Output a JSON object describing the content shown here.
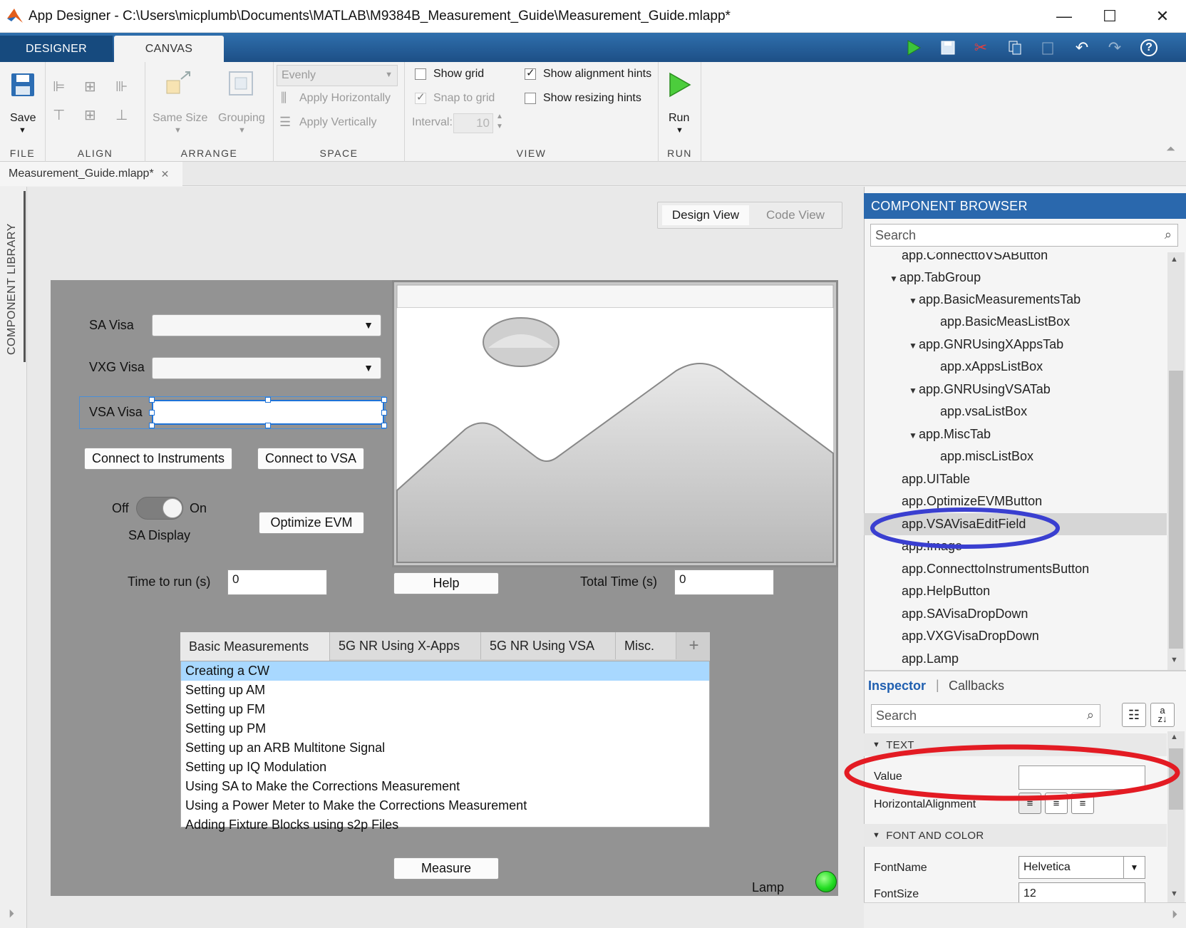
{
  "window": {
    "title": "App Designer - C:\\Users\\micplumb\\Documents\\MATLAB\\M9384B_Measurement_Guide\\Measurement_Guide.mlapp*",
    "minimize": "—",
    "maximize": "☐",
    "close": "✕"
  },
  "ribbon_tabs": [
    "DESIGNER",
    "CANVAS"
  ],
  "ribbon": {
    "file": {
      "title": "FILE",
      "save": "Save"
    },
    "align": {
      "title": "ALIGN"
    },
    "arrange": {
      "title": "ARRANGE",
      "same_size": "Same Size",
      "grouping": "Grouping"
    },
    "space": {
      "title": "SPACE",
      "select_value": "Evenly",
      "apply_h": "Apply Horizontally",
      "apply_v": "Apply Vertically"
    },
    "view": {
      "title": "VIEW",
      "show_grid": "Show grid",
      "snap_to_grid": "Snap to grid",
      "interval_label": "Interval:",
      "interval_value": "10",
      "show_alignment_hints": "Show alignment hints",
      "show_resizing_hints": "Show resizing hints",
      "show_grid_checked": false,
      "snap_checked": true,
      "alignment_checked": true,
      "resizing_checked": false
    },
    "run": {
      "title": "RUN",
      "run": "Run"
    }
  },
  "document_tab": {
    "label": "Measurement_Guide.mlapp*",
    "close": "✕"
  },
  "left_panel": {
    "label": "COMPONENT LIBRARY"
  },
  "view_toggle": {
    "design": "Design View",
    "code": "Code View"
  },
  "app": {
    "sa_visa_label": "SA Visa",
    "vxg_visa_label": "VXG Visa",
    "vsa_visa_label": "VSA Visa",
    "connect_instruments": "Connect to Instruments",
    "connect_vsa": "Connect to VSA",
    "switch_off": "Off",
    "switch_on": "On",
    "sa_display": "SA Display",
    "optimize_evm": "Optimize EVM",
    "time_to_run_label": "Time to run (s)",
    "time_to_run_value": "0",
    "help": "Help",
    "total_time_label": "Total Time (s)",
    "total_time_value": "0",
    "tabs": [
      "Basic Measurements",
      "5G NR Using X-Apps",
      "5G NR Using VSA",
      "Misc."
    ],
    "add_tab": "+",
    "list_items": [
      "Creating a CW",
      "Setting up AM",
      "Setting up FM",
      "Setting up PM",
      "Setting up an ARB Multitone Signal",
      "Setting up IQ Modulation",
      "Using SA to Make the Corrections Measurement",
      "Using a Power Meter to Make the Corrections Measurement",
      "Adding Fixture Blocks using s2p Files"
    ],
    "measure": "Measure",
    "lamp_label": "Lamp",
    "lamp_color": "#22dd22"
  },
  "component_browser": {
    "title": "COMPONENT BROWSER",
    "search_placeholder": "Search",
    "items": [
      "app.ConnecttoVSAButton",
      "app.TabGroup",
      "app.BasicMeasurementsTab",
      "app.BasicMeasListBox",
      "app.GNRUsingXAppsTab",
      "app.xAppsListBox",
      "app.GNRUsingVSATab",
      "app.vsaListBox",
      "app.MiscTab",
      "app.miscListBox",
      "app.UITable",
      "app.OptimizeEVMButton",
      "app.VSAVisaEditField",
      "app.Image",
      "app.ConnecttoInstrumentsButton",
      "app.HelpButton",
      "app.SAVisaDropDown",
      "app.VXGVisaDropDown",
      "app.Lamp"
    ],
    "selected": "app.VSAVisaEditField"
  },
  "inspector": {
    "tab_inspector": "Inspector",
    "tab_callbacks": "Callbacks",
    "search_placeholder": "Search",
    "section_text": "TEXT",
    "value_label": "Value",
    "value": "",
    "halign_label": "HorizontalAlignment",
    "section_font": "FONT AND COLOR",
    "fontname_label": "FontName",
    "fontname_value": "Helvetica",
    "fontsize_label": "FontSize",
    "fontsize_value": "12"
  },
  "colors": {
    "accent": "#2a68ad",
    "highlight_blue": "#3a3fd0",
    "highlight_red": "#e31b23",
    "list_selection": "#a8d8ff"
  }
}
